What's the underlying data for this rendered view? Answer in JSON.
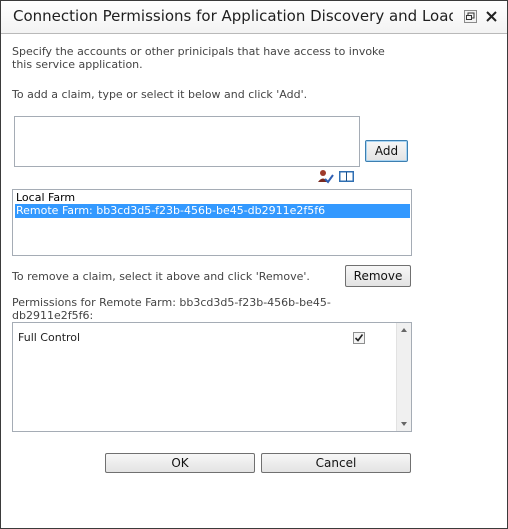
{
  "dialog": {
    "title": "Connection Permissions for Application Discovery and Load...",
    "intro_line1": "Specify the accounts or other prinicipals that have access to invoke",
    "intro_line2": "this service application.",
    "claim_instruction": "To add a claim, type or select it below and click 'Add'.",
    "claim_input_value": "",
    "add_label": "Add",
    "principals": [
      {
        "label": "Local Farm",
        "selected": false
      },
      {
        "label": "Remote Farm: bb3cd3d5-f23b-456b-be45-db2911e2f5f6",
        "selected": true
      }
    ],
    "remove_instruction": "To remove a claim, select it above and click 'Remove'.",
    "remove_label": "Remove",
    "permissions_heading_line1": "Permissions for Remote Farm: bb3cd3d5-f23b-456b-be45-",
    "permissions_heading_line2": "db2911e2f5f6:",
    "permissions": [
      {
        "label": "Full Control",
        "checked": true
      }
    ],
    "ok_label": "OK",
    "cancel_label": "Cancel",
    "colors": {
      "selection": "#3399ff",
      "border": "#a5acb5"
    }
  }
}
